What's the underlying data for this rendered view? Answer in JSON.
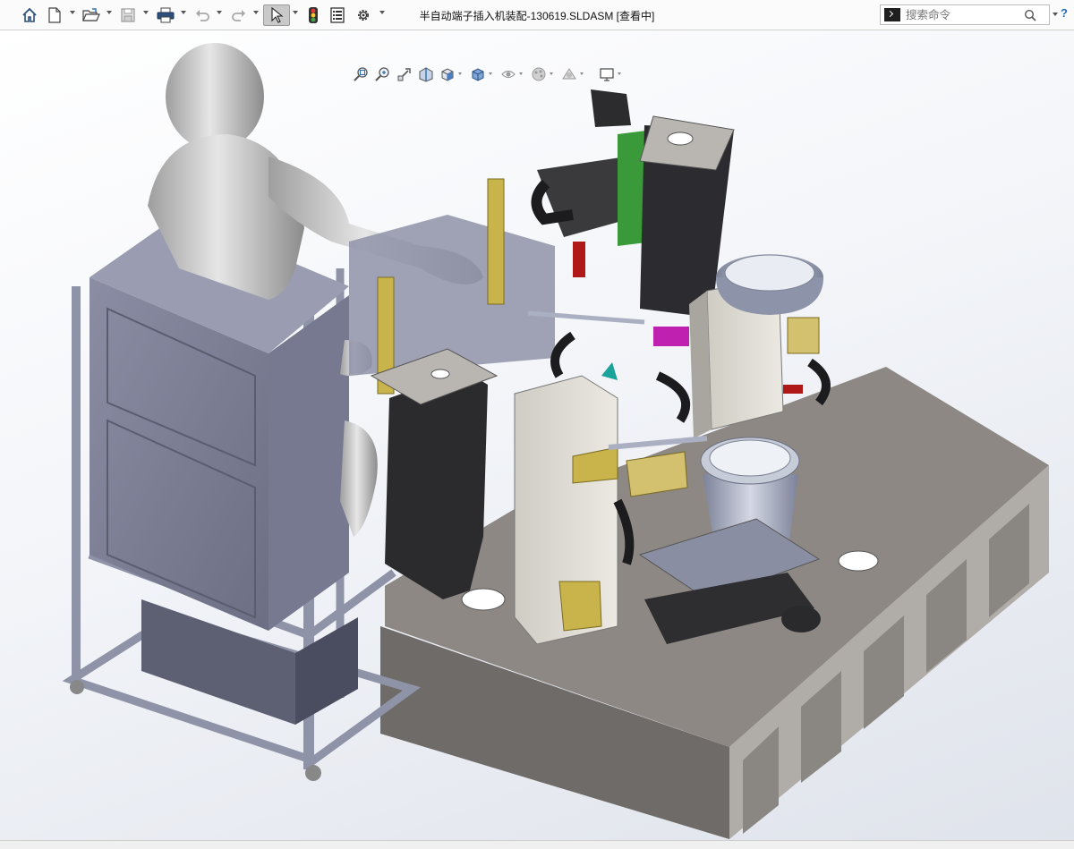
{
  "window": {
    "title": "半自动端子插入机装配-130619.SLDASM [查看中]"
  },
  "search": {
    "placeholder": "搜索命令"
  },
  "toolbar": {
    "items": [
      {
        "icon": "home-icon"
      },
      {
        "icon": "new-document-icon"
      },
      {
        "icon": "open-folder-icon"
      },
      {
        "icon": "save-icon"
      },
      {
        "icon": "print-icon"
      },
      {
        "icon": "undo-icon"
      },
      {
        "icon": "redo-icon"
      },
      {
        "icon": "select-cursor-icon"
      },
      {
        "icon": "traffic-light-icon"
      },
      {
        "icon": "file-properties-icon"
      },
      {
        "icon": "gear-icon"
      }
    ]
  },
  "heads_up_toolbar": {
    "items": [
      {
        "icon": "zoom-to-fit-icon"
      },
      {
        "icon": "zoom-to-area-icon"
      },
      {
        "icon": "previous-view-icon"
      },
      {
        "icon": "section-view-icon"
      },
      {
        "icon": "view-orientation-icon"
      },
      {
        "icon": "display-style-icon"
      },
      {
        "icon": "hide-show-items-icon"
      },
      {
        "icon": "edit-appearance-icon"
      },
      {
        "icon": "apply-scene-icon"
      },
      {
        "icon": "view-settings-icon"
      }
    ]
  },
  "colors": {
    "cabinet": "#7c7f95",
    "frame": "#8f93a8",
    "table_top": "#8c8783",
    "table_side": "#a7a39f",
    "mannequin": "#c4c4c4",
    "dark_part": "#3a3a3d",
    "bowl": "#a9afc2",
    "accent_yellow": "#c8b44a",
    "accent_magenta": "#c020b0",
    "accent_green": "#3a9a3a",
    "accent_red": "#b01818"
  }
}
